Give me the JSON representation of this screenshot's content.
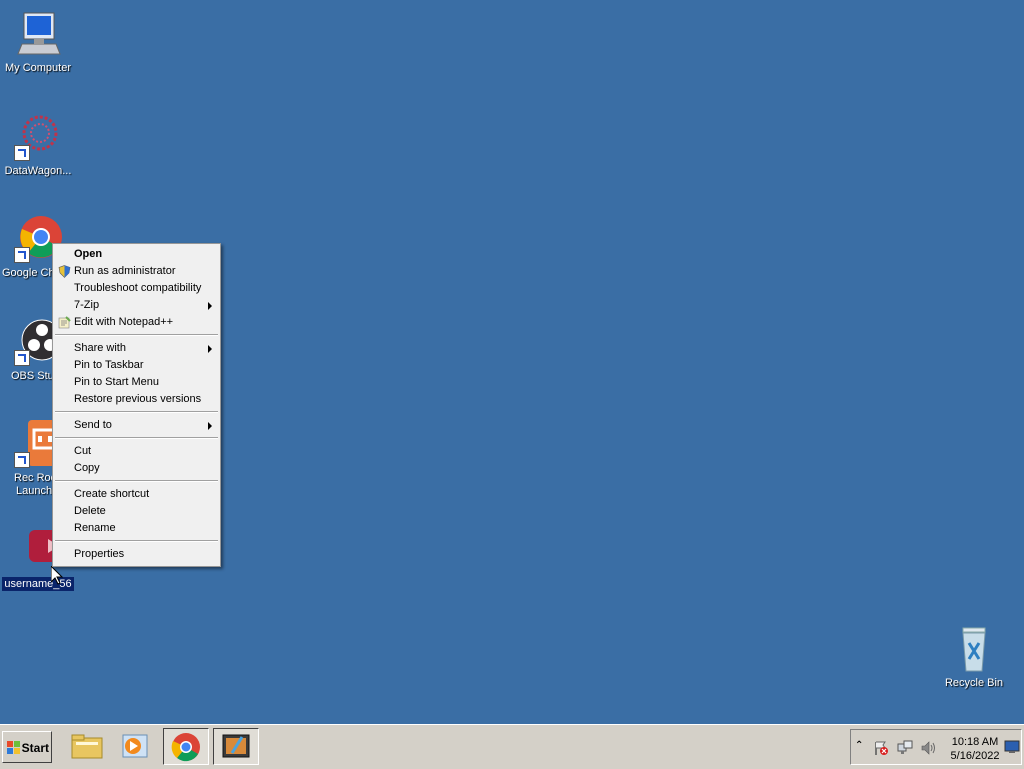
{
  "desktop": {
    "icons": [
      {
        "label": "My Computer"
      },
      {
        "label": "DataWagon..."
      },
      {
        "label": "Google Ch"
      },
      {
        "label": "OBS Stu"
      },
      {
        "label": "Rec Roo",
        "label2": "Launch"
      },
      {
        "label": "username_56"
      },
      {
        "label": "Recycle Bin"
      }
    ]
  },
  "context_menu": {
    "items": [
      {
        "label": "Open"
      },
      {
        "label": "Run as administrator"
      },
      {
        "label": "Troubleshoot compatibility"
      },
      {
        "label": "7-Zip"
      },
      {
        "label": "Edit with Notepad++"
      },
      {
        "label": "Share with"
      },
      {
        "label": "Pin to Taskbar"
      },
      {
        "label": "Pin to Start Menu"
      },
      {
        "label": "Restore previous versions"
      },
      {
        "label": "Send to"
      },
      {
        "label": "Cut"
      },
      {
        "label": "Copy"
      },
      {
        "label": "Create shortcut"
      },
      {
        "label": "Delete"
      },
      {
        "label": "Rename"
      },
      {
        "label": "Properties"
      }
    ]
  },
  "taskbar": {
    "start_label": "Start",
    "clock_time": "10:18 AM",
    "clock_date": "5/16/2022"
  }
}
